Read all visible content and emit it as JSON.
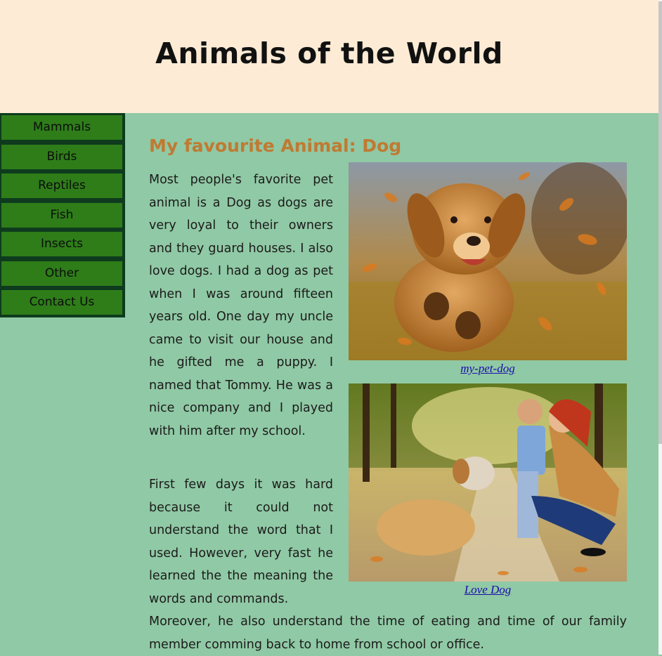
{
  "header": {
    "title": "Animals of the World"
  },
  "nav": {
    "items": [
      {
        "label": "Mammals"
      },
      {
        "label": "Birds"
      },
      {
        "label": "Reptiles"
      },
      {
        "label": "Fish"
      },
      {
        "label": "Insects"
      },
      {
        "label": "Other"
      },
      {
        "label": "Contact Us"
      }
    ]
  },
  "main": {
    "heading": "My favourite Animal: Dog",
    "paragraph1": "Most people's favorite pet animal is a Dog as dogs are very loyal to their owners and they guard houses. I also love dogs. I had a dog as pet when I was around fifteen years old. One day my uncle came to visit our house and he gifted me a puppy. I named that Tommy. He was a nice company and I played with him after my school.",
    "paragraph2": "First few days it was hard because it could not understand the word that I used. However, very fast he learned the the meaning the words and commands.",
    "paragraph2_cont": "Moreover, he also understand the time of eating and time of our family member comming back to home from school or office."
  },
  "figures": [
    {
      "caption": "my-pet-dog"
    },
    {
      "caption": "Love Dog"
    }
  ]
}
